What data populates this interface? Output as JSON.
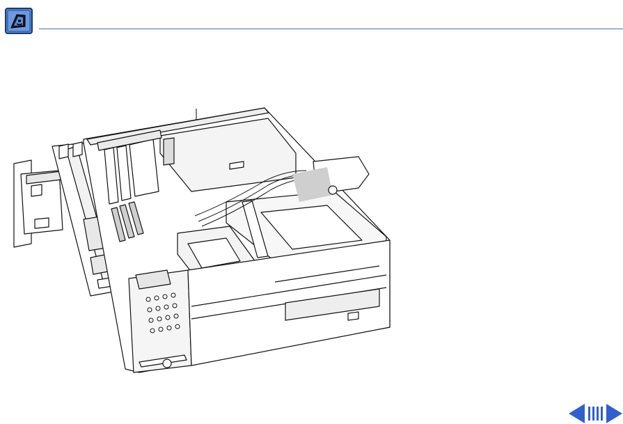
{
  "header": {
    "icon": "mac-os-logo-icon",
    "rule_color": "#4a6fa5"
  },
  "figure": {
    "subject": "computer-chassis-illustration",
    "callout": "leader-line"
  },
  "navigation": {
    "prev_icon": "arrow-left-icon",
    "index_icon": "book-index-icon",
    "next_icon": "arrow-right-icon",
    "accent_color": "#2f5fd0"
  }
}
